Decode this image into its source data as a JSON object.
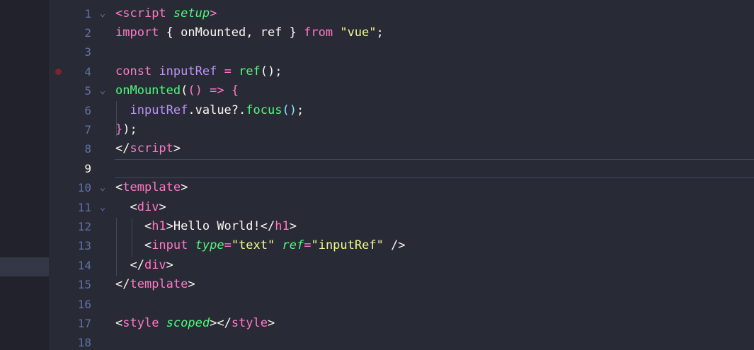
{
  "editor": {
    "language": "vue",
    "current_line": 9,
    "breakpoint_line": 4,
    "lines": [
      {
        "n": "1",
        "fold": "⌄",
        "tokens": [
          [
            "tag",
            "<"
          ],
          [
            "tag",
            "script"
          ],
          [
            "txt",
            " "
          ],
          [
            "attr",
            "setup"
          ],
          [
            "tag",
            ">"
          ]
        ]
      },
      {
        "n": "2",
        "fold": "",
        "tokens": [
          [
            "kw",
            "import"
          ],
          [
            "txt",
            " { onMounted, ref } "
          ],
          [
            "kw",
            "from"
          ],
          [
            "txt",
            " "
          ],
          [
            "str",
            "\"vue\""
          ],
          [
            "txt",
            ";"
          ]
        ]
      },
      {
        "n": "3",
        "fold": "",
        "tokens": []
      },
      {
        "n": "4",
        "fold": "",
        "tokens": [
          [
            "kw",
            "const"
          ],
          [
            "txt",
            " "
          ],
          [
            "var",
            "inputRef"
          ],
          [
            "txt",
            " "
          ],
          [
            "kw",
            "="
          ],
          [
            "txt",
            " "
          ],
          [
            "fn",
            "ref"
          ],
          [
            "txt",
            "();"
          ]
        ]
      },
      {
        "n": "5",
        "fold": "⌄",
        "tokens": [
          [
            "fn",
            "onMounted"
          ],
          [
            "txt",
            "("
          ],
          [
            "par",
            "() "
          ],
          [
            "kw",
            "=>"
          ],
          [
            "txt",
            " "
          ],
          [
            "par",
            "{"
          ]
        ]
      },
      {
        "n": "6",
        "fold": "",
        "tokens": [
          [
            "txt",
            "  "
          ],
          [
            "var",
            "inputRef"
          ],
          [
            "txt",
            ".value?."
          ],
          [
            "fn",
            "focus"
          ],
          [
            "br2",
            "()"
          ],
          [
            "txt",
            ";"
          ]
        ]
      },
      {
        "n": "7",
        "fold": "",
        "tokens": [
          [
            "par",
            "}"
          ],
          [
            "txt",
            ");"
          ]
        ]
      },
      {
        "n": "8",
        "fold": "",
        "tokens": [
          [
            "txt",
            "</"
          ],
          [
            "tag",
            "script"
          ],
          [
            "txt",
            ">"
          ]
        ]
      },
      {
        "n": "9",
        "fold": "",
        "tokens": []
      },
      {
        "n": "10",
        "fold": "⌄",
        "tokens": [
          [
            "txt",
            "<"
          ],
          [
            "tag",
            "template"
          ],
          [
            "txt",
            ">"
          ]
        ]
      },
      {
        "n": "11",
        "fold": "⌄",
        "tokens": [
          [
            "txt",
            "  <"
          ],
          [
            "tag",
            "div"
          ],
          [
            "txt",
            ">"
          ]
        ]
      },
      {
        "n": "12",
        "fold": "",
        "tokens": [
          [
            "txt",
            "    <"
          ],
          [
            "tag",
            "h1"
          ],
          [
            "txt",
            ">Hello World!</"
          ],
          [
            "tag",
            "h1"
          ],
          [
            "txt",
            ">"
          ]
        ]
      },
      {
        "n": "13",
        "fold": "",
        "tokens": [
          [
            "txt",
            "    <"
          ],
          [
            "tag",
            "input"
          ],
          [
            "txt",
            " "
          ],
          [
            "attr",
            "type"
          ],
          [
            "kw",
            "="
          ],
          [
            "str",
            "\"text\""
          ],
          [
            "txt",
            " "
          ],
          [
            "attr",
            "ref"
          ],
          [
            "kw",
            "="
          ],
          [
            "str",
            "\"inputRef\""
          ],
          [
            "txt",
            " />"
          ]
        ]
      },
      {
        "n": "14",
        "fold": "",
        "tokens": [
          [
            "txt",
            "  </"
          ],
          [
            "tag",
            "div"
          ],
          [
            "txt",
            ">"
          ]
        ]
      },
      {
        "n": "15",
        "fold": "",
        "tokens": [
          [
            "txt",
            "</"
          ],
          [
            "tag",
            "template"
          ],
          [
            "txt",
            ">"
          ]
        ]
      },
      {
        "n": "16",
        "fold": "",
        "tokens": []
      },
      {
        "n": "17",
        "fold": "",
        "tokens": [
          [
            "txt",
            "<"
          ],
          [
            "tag",
            "style"
          ],
          [
            "txt",
            " "
          ],
          [
            "attr",
            "scoped"
          ],
          [
            "txt",
            "></"
          ],
          [
            "tag",
            "style"
          ],
          [
            "txt",
            ">"
          ]
        ]
      },
      {
        "n": "18",
        "fold": "",
        "tokens": []
      }
    ]
  },
  "colors": {
    "background": "#282a36",
    "keyword": "#ff79c6",
    "string": "#f1fa8c",
    "function": "#50fa7b",
    "variable": "#bd93f9",
    "breakpoint": "#7a2530"
  },
  "icons": {
    "fold": "chevron-down-icon",
    "breakpoint": "breakpoint-dot-icon"
  }
}
